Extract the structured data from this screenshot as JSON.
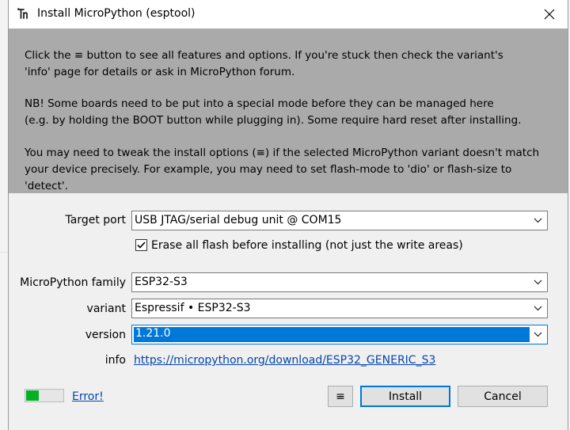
{
  "window": {
    "title": "Install MicroPython (esptool)",
    "app_icon": "thonny-icon",
    "close_icon": "close-icon"
  },
  "banner": {
    "paragraph1_line1": "Click the ≡ button to see all features and options. If you're stuck then check the variant's",
    "paragraph1_line2": "'info' page for details or ask in MicroPython forum.",
    "paragraph2_line1": "NB! Some boards need to be put into a special mode before they can be managed here",
    "paragraph2_line2": "(e.g. by holding the BOOT button while plugging in). Some require hard reset after installing.",
    "paragraph3_line1": "You may need to tweak the install options (≡) if the selected MicroPython variant doesn't match",
    "paragraph3_line2": "your device precisely. For example, you may need to set flash-mode to 'dio' or flash-size to 'detect'."
  },
  "form": {
    "target_port_label": "Target port",
    "target_port_value": "USB JTAG/serial debug unit @ COM15",
    "erase_label": "Erase all flash before installing (not just the write areas)",
    "erase_checked": true,
    "family_label": "MicroPython family",
    "family_value": "ESP32-S3",
    "variant_label": "variant",
    "variant_value": "Espressif • ESP32-S3",
    "version_label": "version",
    "version_value": "1.21.0",
    "info_label": "info",
    "info_link": "https://micropython.org/download/ESP32_GENERIC_S3"
  },
  "footer": {
    "progress_fraction": 0.35,
    "progress_color": "#06b025",
    "error_link": "Error!",
    "menu_button": "≡",
    "install_button": "Install",
    "cancel_button": "Cancel"
  },
  "colors": {
    "banner_bg": "#aaaaaa",
    "accent": "#0078d7",
    "link": "#0645ad"
  }
}
